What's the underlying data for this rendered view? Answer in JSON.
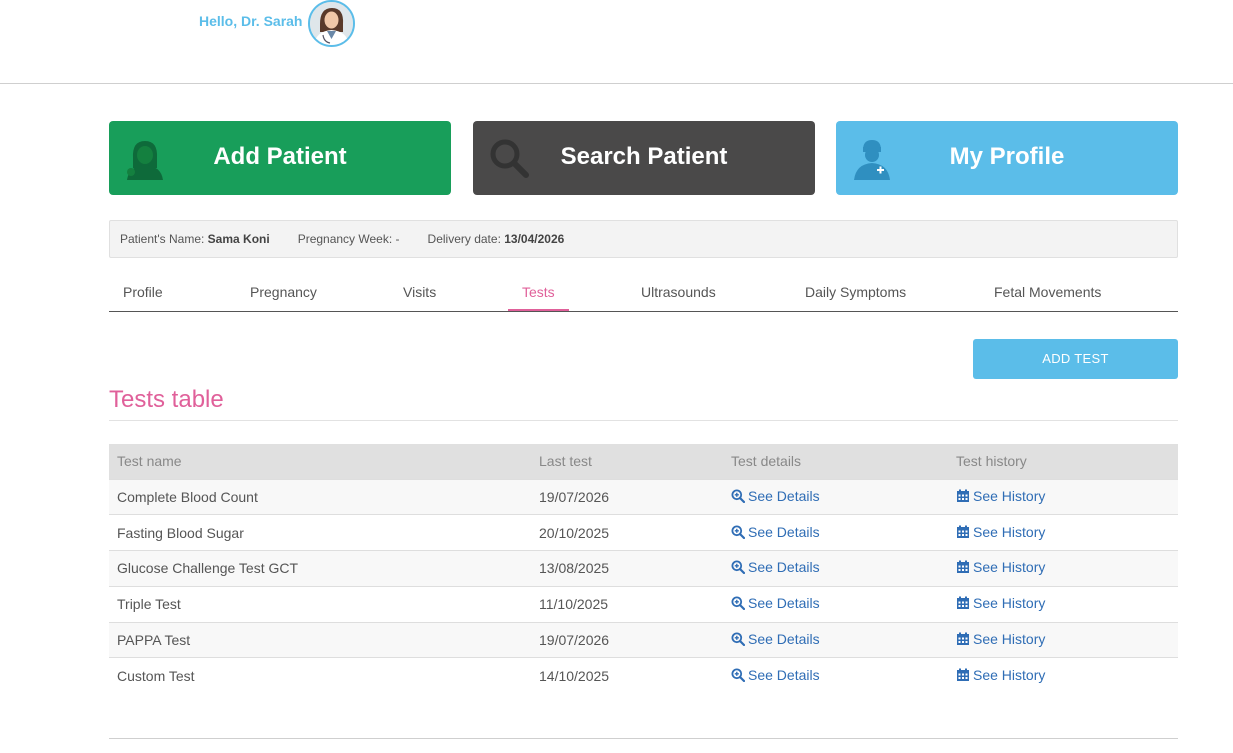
{
  "header": {
    "greeting": "Hello, Dr. Sarah"
  },
  "actions": {
    "add_patient": "Add Patient",
    "search_patient": "Search Patient",
    "my_profile": "My Profile"
  },
  "patient": {
    "name_label": "Patient's Name:",
    "name_value": "Sama Koni",
    "week_label": "Pregnancy Week:",
    "week_value": "-",
    "delivery_label": "Delivery date:",
    "delivery_value": "13/04/2026"
  },
  "tabs": [
    {
      "label": "Profile"
    },
    {
      "label": "Pregnancy"
    },
    {
      "label": "Visits"
    },
    {
      "label": "Tests",
      "active": true
    },
    {
      "label": "Ultrasounds"
    },
    {
      "label": "Daily Symptoms"
    },
    {
      "label": "Fetal Movements"
    }
  ],
  "add_test_label": "ADD TEST",
  "section_title": "Tests table",
  "table": {
    "headers": [
      "Test name",
      "Last test",
      "Test details",
      "Test history"
    ],
    "details_link": "See Details",
    "history_link": "See History",
    "rows": [
      {
        "name": "Complete Blood Count",
        "last": "19/07/2026"
      },
      {
        "name": "Fasting Blood Sugar",
        "last": "20/10/2025"
      },
      {
        "name": "Glucose Challenge Test GCT",
        "last": "13/08/2025"
      },
      {
        "name": "Triple Test",
        "last": "11/10/2025"
      },
      {
        "name": "PAPPA Test",
        "last": "19/07/2026"
      },
      {
        "name": "Custom Test",
        "last": "14/10/2025"
      }
    ]
  },
  "colors": {
    "green": "#189e5a",
    "dark": "#4a4949",
    "blue": "#5bbde9",
    "pink": "#e0609a",
    "link": "#2f6db5"
  }
}
